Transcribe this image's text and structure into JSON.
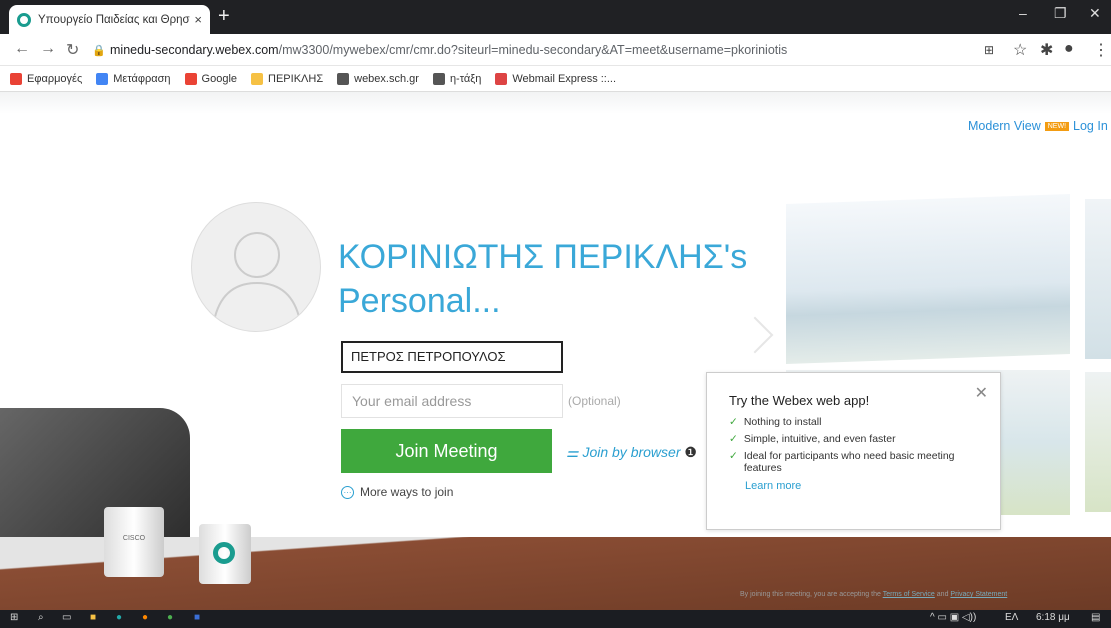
{
  "browser": {
    "tab_title": "Υπουργείο Παιδείας και Θρησκε",
    "tab_close": "×",
    "new_tab": "+",
    "url_domain": "minedu-secondary.webex.com",
    "url_path": "/mw3300/mywebex/cmr/cmr.do?siteurl=minedu-secondary&AT=meet&username=pkoriniotis",
    "bookmarks": [
      {
        "label": "Εφαρμογές",
        "color": "#e94235"
      },
      {
        "label": "Μετάφραση",
        "color": "#4285f4"
      },
      {
        "label": "Google",
        "color": "#ea4335"
      },
      {
        "label": "ΠΕΡΙΚΛΗΣ",
        "color": "#f6c144"
      },
      {
        "label": "webex.sch.gr",
        "color": "#555"
      },
      {
        "label": "η-τάξη",
        "color": "#555"
      },
      {
        "label": "Webmail Express ::...",
        "color": "#d44"
      }
    ]
  },
  "page": {
    "modern_view": "Modern View",
    "new_badge": "NEW!",
    "log_in": "Log In",
    "room_title_line1": "ΚΟΡΙΝΙΩΤΗΣ ΠΕΡΙΚΛΗΣ's",
    "room_title_line2": "Personal...",
    "name_value": "ΠΕΤΡΟΣ ΠΕΤΡΟΠΟΥΛΟΣ",
    "email_placeholder": "Your email address",
    "optional": "(Optional)",
    "join_button": "Join Meeting",
    "join_browser": "Join by browser",
    "more_ways": "More ways to join",
    "mug_logo": "CISCO",
    "legal": "By joining this meeting, you are accepting the",
    "terms": "Terms of Service",
    "and": "and",
    "privacy": "Privacy Statement"
  },
  "popup": {
    "title": "Try the Webex web app!",
    "items": [
      "Nothing to install",
      "Simple, intuitive, and even faster",
      "Ideal for participants who need basic meeting features"
    ],
    "learn_more": "Learn more"
  },
  "taskbar": {
    "lang": "ΕΛ",
    "time": "6:18 μμ"
  }
}
